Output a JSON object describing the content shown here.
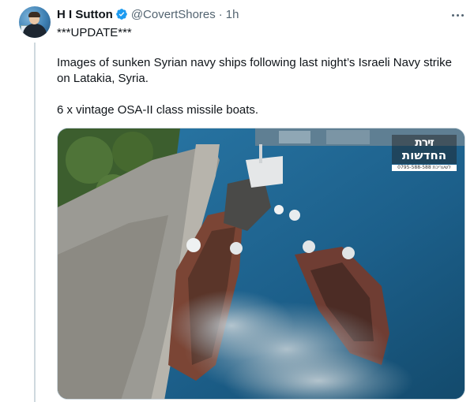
{
  "author": {
    "name": "H I Sutton",
    "handle": "@CovertShores",
    "separator": "·",
    "time": "1h",
    "verified": true,
    "avatar_icon": "user-avatar"
  },
  "tweet": {
    "lines": [
      "***UPDATE***",
      "Images of sunken Syrian navy ships following last night’s Israeli Navy strike on Latakia, Syria.",
      "6 x vintage OSA-II class missile boats."
    ]
  },
  "media": {
    "watermark_title": "החדשות",
    "watermark_top": "זירת",
    "watermark_sub": "0795-588-588 לשעריכת"
  },
  "colors": {
    "verified": "#1d9bf0",
    "text": "#0f1419",
    "secondary": "#536471",
    "water": "#1f5f86"
  }
}
